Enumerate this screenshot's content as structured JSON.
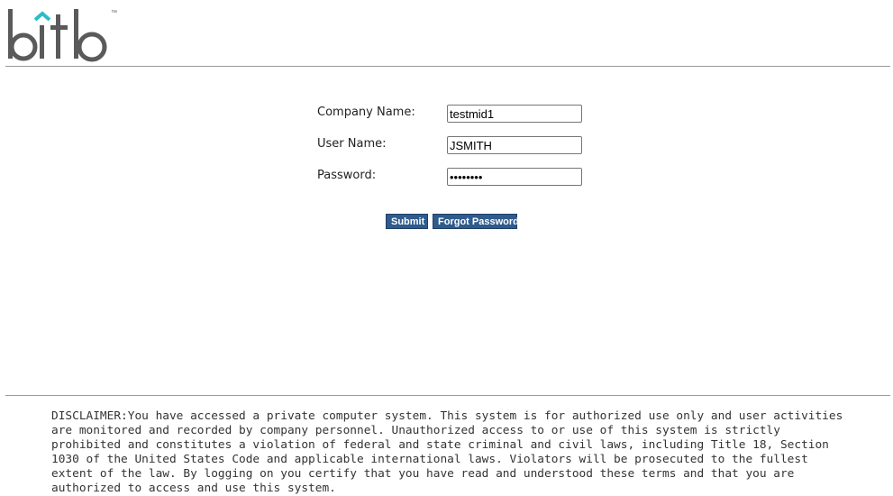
{
  "brand": {
    "logo_text": "bitb",
    "trademark": "™",
    "accent_color": "#2bbcc9",
    "logo_color": "#5a5a5a"
  },
  "form": {
    "company_label": "Company Name:",
    "company_value": "testmid1",
    "username_label": "User Name:",
    "username_value": "JSMITH",
    "password_label": "Password:",
    "password_value": "password"
  },
  "actions": {
    "submit_label": "Submit",
    "forgot_label": "Forgot Password",
    "button_color": "#2f5b8d"
  },
  "footer": {
    "disclaimer": "DISCLAIMER:You have accessed a private computer system. This system is for authorized use only and user activities are monitored and recorded by company personnel. Unauthorized access to or use of this system is strictly prohibited and constitutes a violation of federal and state criminal and civil laws, including Title 18, Section 1030 of the United States Code and applicable international laws. Violators will be prosecuted to the fullest extent of the law. By logging on you certify that you have read and understood these terms and that you are authorized to access and use this system."
  }
}
